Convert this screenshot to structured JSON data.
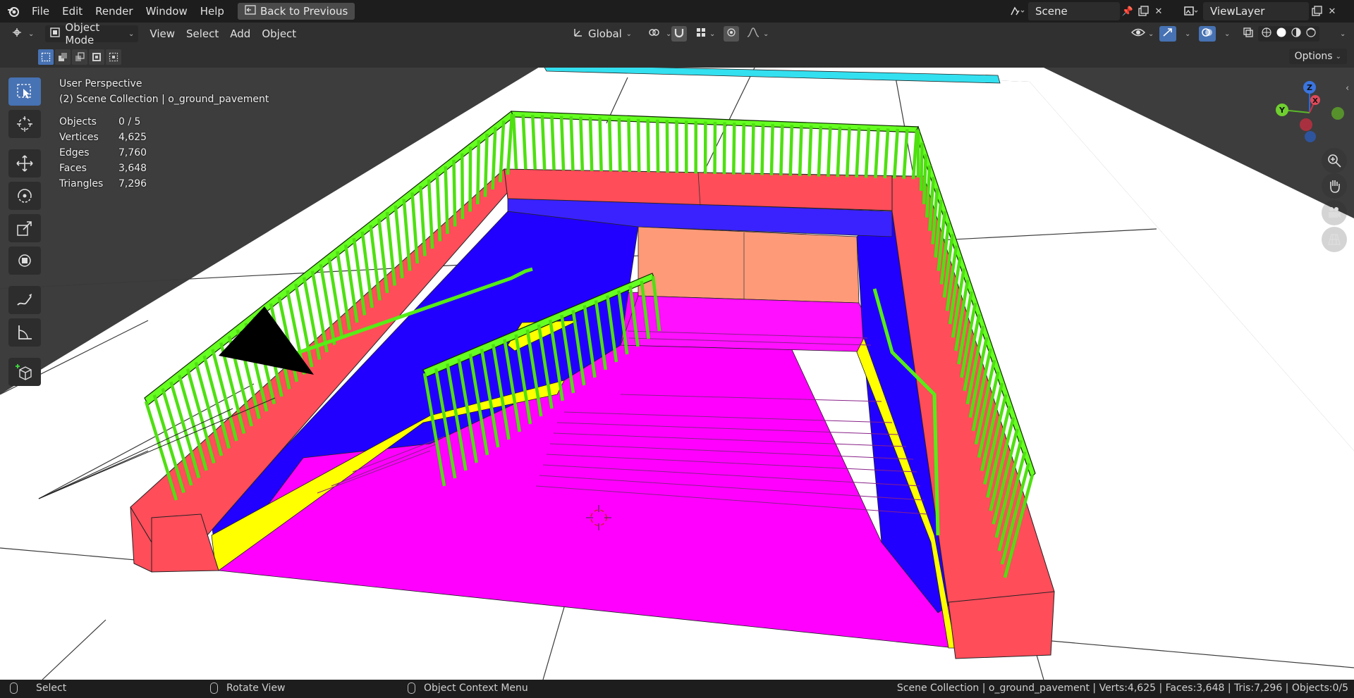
{
  "topbar": {
    "menus": [
      "File",
      "Edit",
      "Render",
      "Window",
      "Help"
    ],
    "back_button": "Back to Previous",
    "scene_name": "Scene",
    "view_layer": "ViewLayer"
  },
  "header": {
    "mode": "Object Mode",
    "menus": [
      "View",
      "Select",
      "Add",
      "Object"
    ],
    "orientation": "Global"
  },
  "toolrow": {
    "options": "Options"
  },
  "overlay": {
    "perspective": "User Perspective",
    "collection": "(2) Scene Collection | o_ground_pavement",
    "stats": [
      {
        "label": "Objects",
        "value": "0 / 5"
      },
      {
        "label": "Vertices",
        "value": "4,625"
      },
      {
        "label": "Edges",
        "value": "7,760"
      },
      {
        "label": "Faces",
        "value": "3,648"
      },
      {
        "label": "Triangles",
        "value": "7,296"
      }
    ]
  },
  "gizmo": {
    "z": "Z",
    "y": "Y",
    "x": "X"
  },
  "statusbar": {
    "select": "Select",
    "rotate": "Rotate View",
    "context": "Object Context Menu",
    "summary": "Scene Collection | o_ground_pavement | Verts:4,625 | Faces:3,648 | Tris:7,296 | Objects:0/5"
  },
  "colors": {
    "accent": "#4772b3",
    "railing": "#66ff22",
    "wall_red": "#ff4d5a",
    "wall_blue": "#2200ff",
    "floor_magenta": "#ff00ff",
    "landing_salmon": "#ff9a78",
    "curb_yellow": "#ffff00",
    "ground": "#ffffff"
  }
}
